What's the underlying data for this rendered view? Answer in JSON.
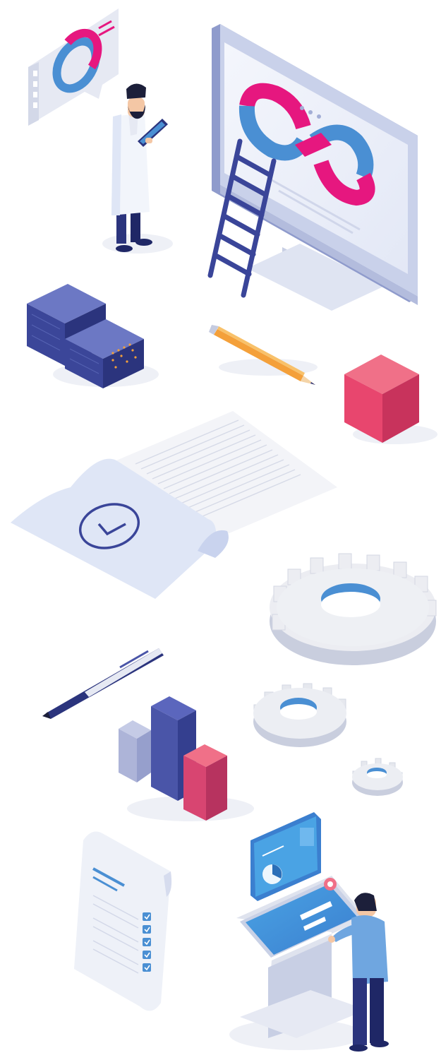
{
  "scene": {
    "background": "#ffffff",
    "palette": {
      "navy": "#2b347d",
      "indigo": "#4a55a8",
      "blue": "#4a8fd3",
      "light_blue": "#dfe6f6",
      "magenta": "#e6177f",
      "coral": "#f07088",
      "orange": "#f4a03a",
      "grey": "#e9ebf0"
    },
    "icons": [
      "speech-bubble-donut-chart-icon",
      "scientist-with-tablet-icon",
      "monitor-infinity-loop-icon",
      "ladder-icon",
      "server-racks-icon",
      "pencil-icon",
      "cube-icon",
      "document-checkmark-icon",
      "large-gear-icon",
      "pen-icon",
      "bar-chart-icon",
      "medium-gear-icon",
      "small-gear-icon",
      "checklist-scroll-icon",
      "touchscreen-kiosk-icon",
      "man-at-kiosk-icon"
    ]
  }
}
